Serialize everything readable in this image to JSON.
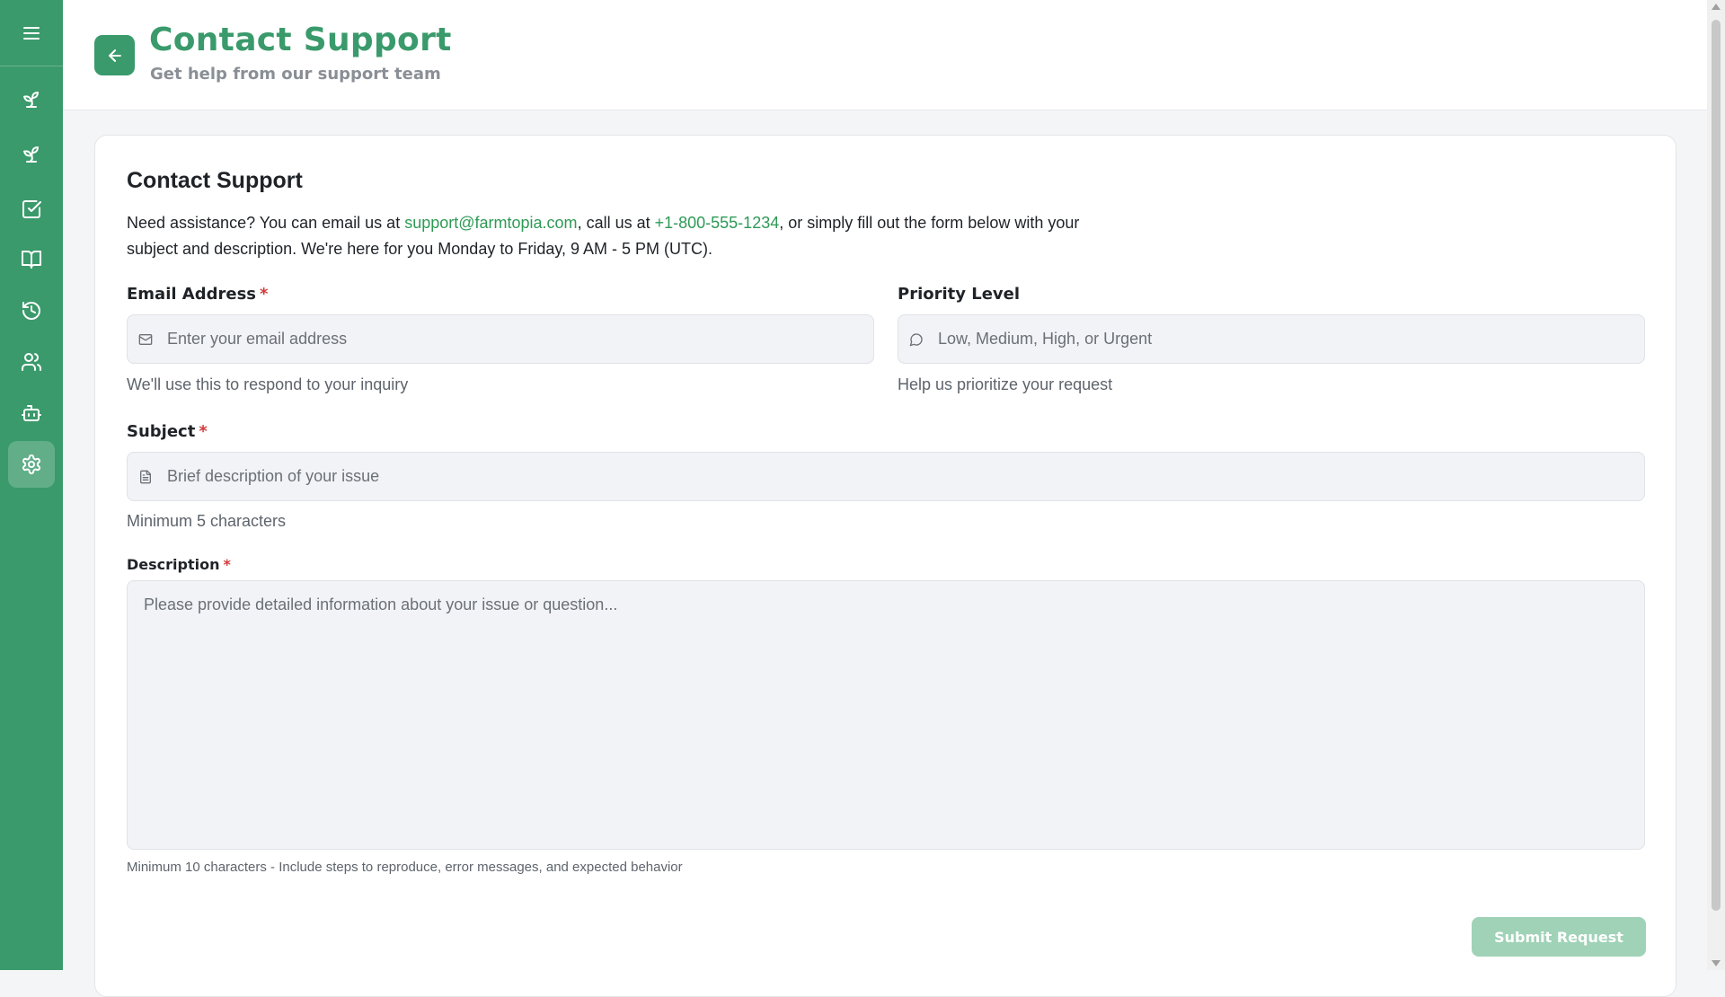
{
  "header": {
    "title": "Contact Support",
    "subtitle": "Get help from our support team"
  },
  "sidebar": {
    "items": [
      {
        "icon": "sprout-icon"
      },
      {
        "icon": "sprout-icon"
      },
      {
        "icon": "checkbox-icon"
      },
      {
        "icon": "book-icon"
      },
      {
        "icon": "history-icon"
      },
      {
        "icon": "users-icon"
      },
      {
        "icon": "bot-icon"
      },
      {
        "icon": "settings-icon",
        "active": true
      }
    ]
  },
  "card": {
    "title": "Contact Support",
    "intro_before_email": "Need assistance? You can email us at ",
    "email": "support@farmtopia.com",
    "intro_between": ", call us at ",
    "phone": "+1-800-555-1234",
    "intro_after": ", or simply fill out the form below with your subject and description. We're here for you Monday to Friday, 9 AM - 5 PM (UTC)."
  },
  "form": {
    "email": {
      "label": "Email Address",
      "required": "*",
      "placeholder": "Enter your email address",
      "hint": "We'll use this to respond to your inquiry"
    },
    "priority": {
      "label": "Priority Level",
      "placeholder": "Low, Medium, High, or Urgent",
      "hint": "Help us prioritize your request"
    },
    "subject": {
      "label": "Subject",
      "required": "*",
      "placeholder": "Brief description of your issue",
      "hint": "Minimum 5 characters"
    },
    "description": {
      "label": "Description",
      "required": "*",
      "placeholder": "Please provide detailed information about your issue or question...",
      "hint": "Minimum 10 characters - Include steps to reproduce, error messages, and expected behavior"
    },
    "submit_label": "Submit Request"
  },
  "colors": {
    "brand": "#3a9a6b",
    "link": "#2e9a55",
    "required": "#d23b3b",
    "submit_disabled": "#9fd2b7"
  }
}
